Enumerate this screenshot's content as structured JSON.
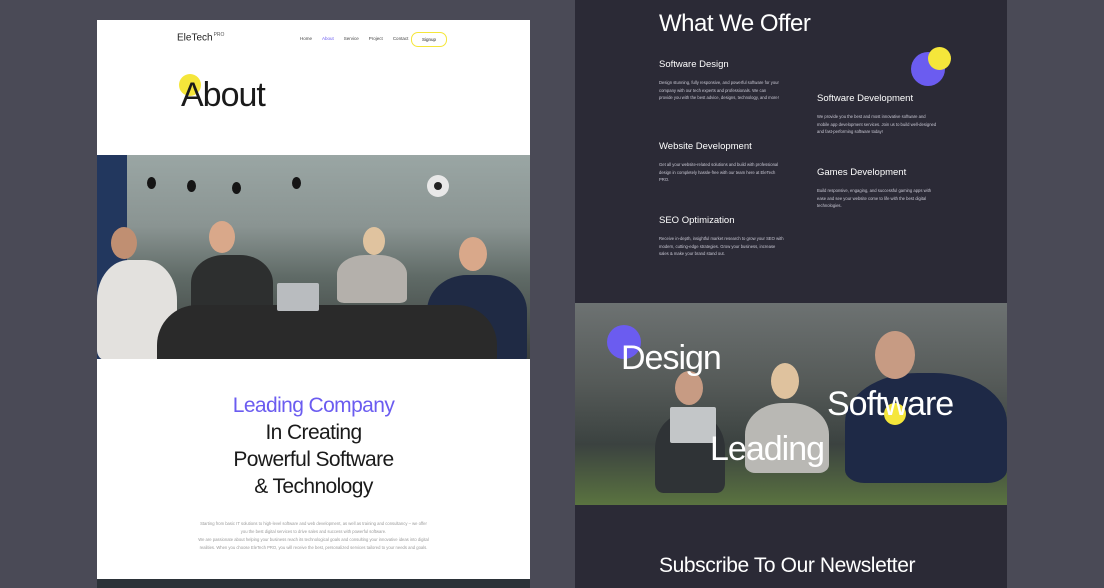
{
  "colors": {
    "accent": "#6b5cf0",
    "highlight": "#f5e63a",
    "dark_panel": "#2b2a36",
    "backdrop": "#4a4a56"
  },
  "left_page": {
    "logo": {
      "name": "EleTech",
      "suffix": "PRO"
    },
    "nav": {
      "items": [
        "Home",
        "About",
        "Service",
        "Project",
        "Contact"
      ],
      "active": "About",
      "signup_label": "Signup"
    },
    "page_title": "About",
    "headline": {
      "accent_line": "Leading Company",
      "lines": [
        "In Creating",
        "Powerful Software",
        "& Technology"
      ]
    },
    "body": [
      "Starting from basic IT solutions to high-level software and web development, as well as training and consultancy – we offer",
      "you the best digital services to drive sales and success with powerful software.",
      "We are passionate about helping your business reach its technological goals and consulting your innovative ideas into digital",
      "realities. When you choose EleTech PRO, you will receive the best, personalized services tailored to your needs and goals."
    ]
  },
  "right_page": {
    "section_title": "What We Offer",
    "services": [
      {
        "title": "Software Design",
        "description": "Design stunning, fully responsive, and powerful software for your company with our tech experts and professionals. We can provide you with the best advice, designs, technology, and more!"
      },
      {
        "title": "Software Development",
        "description": "We provide you the best and most innovative software and mobile app development services. Join us to build well-designed and fast-performing software today!"
      },
      {
        "title": "Website Development",
        "description": "Get all your website-related solutions and build with professional design in completely hassle-free with our team here at EleTech PRO."
      },
      {
        "title": "Games Development",
        "description": "Build responsive, engaging, and successful gaming apps with ease and see your website come to life with the best digital technologies."
      },
      {
        "title": "SEO Optimization",
        "description": "Receive in-depth, insightful market research to grow your SEO with modern, cutting-edge strategies. Grow your business, increase sales & make your brand stand out."
      }
    ],
    "hero_words": [
      "Design",
      "Software",
      "Leading"
    ],
    "newsletter_title": "Subscribe To Our Newsletter"
  }
}
